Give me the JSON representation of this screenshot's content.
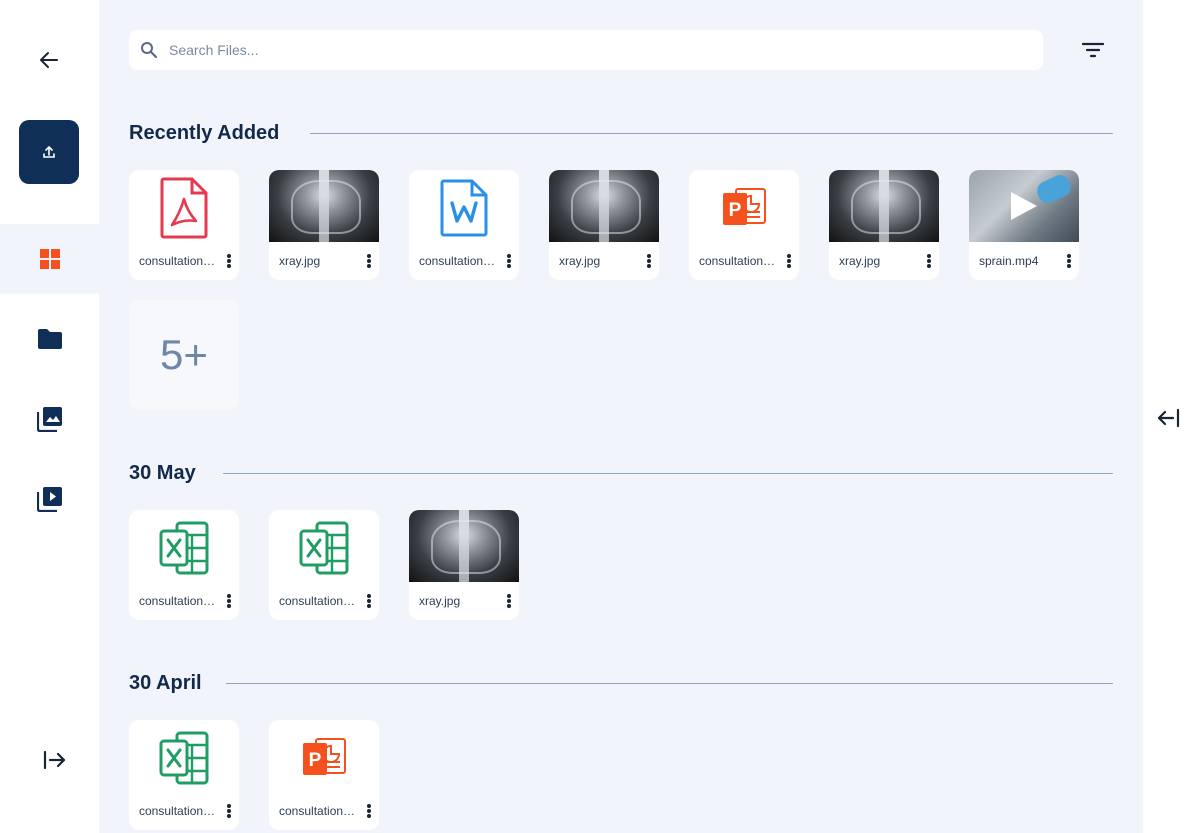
{
  "search": {
    "placeholder": "Search Files..."
  },
  "sections": [
    {
      "title": "Recently Added",
      "files": [
        {
          "name": "consultation.pdf",
          "type": "pdf"
        },
        {
          "name": "xray.jpg",
          "type": "image"
        },
        {
          "name": "consultation.docx",
          "type": "word"
        },
        {
          "name": "xray.jpg",
          "type": "image"
        },
        {
          "name": "consultation.pptx",
          "type": "powerpoint"
        },
        {
          "name": "xray.jpg",
          "type": "image"
        },
        {
          "name": "sprain.mp4",
          "type": "video"
        }
      ],
      "more_label": "5+"
    },
    {
      "title": "30 May",
      "files": [
        {
          "name": "consultation.xlsx",
          "type": "excel"
        },
        {
          "name": "consultation.xlsx",
          "type": "excel"
        },
        {
          "name": "xray.jpg",
          "type": "image"
        }
      ]
    },
    {
      "title": "30 April",
      "files": [
        {
          "name": "consultation.xlsx",
          "type": "excel"
        },
        {
          "name": "consultation.pptx",
          "type": "powerpoint"
        }
      ]
    }
  ],
  "colors": {
    "accent_navy": "#0f2f57",
    "active_tab": "#f4511e",
    "pdf_red": "#e53950",
    "word_blue": "#2b8fe8",
    "excel_green": "#1f9d63",
    "ppt_orange": "#f4511e",
    "panel_bg": "#f1f5fb"
  },
  "icons": {
    "back": "arrow-left-icon",
    "upload": "upload-icon",
    "dashboard": "grid-icon",
    "folder": "folder-icon",
    "gallery": "image-gallery-icon",
    "videos": "video-library-icon",
    "expand": "expand-sidebar-icon",
    "collapse": "collapse-panel-icon",
    "search": "search-icon",
    "filter": "filter-icon"
  }
}
